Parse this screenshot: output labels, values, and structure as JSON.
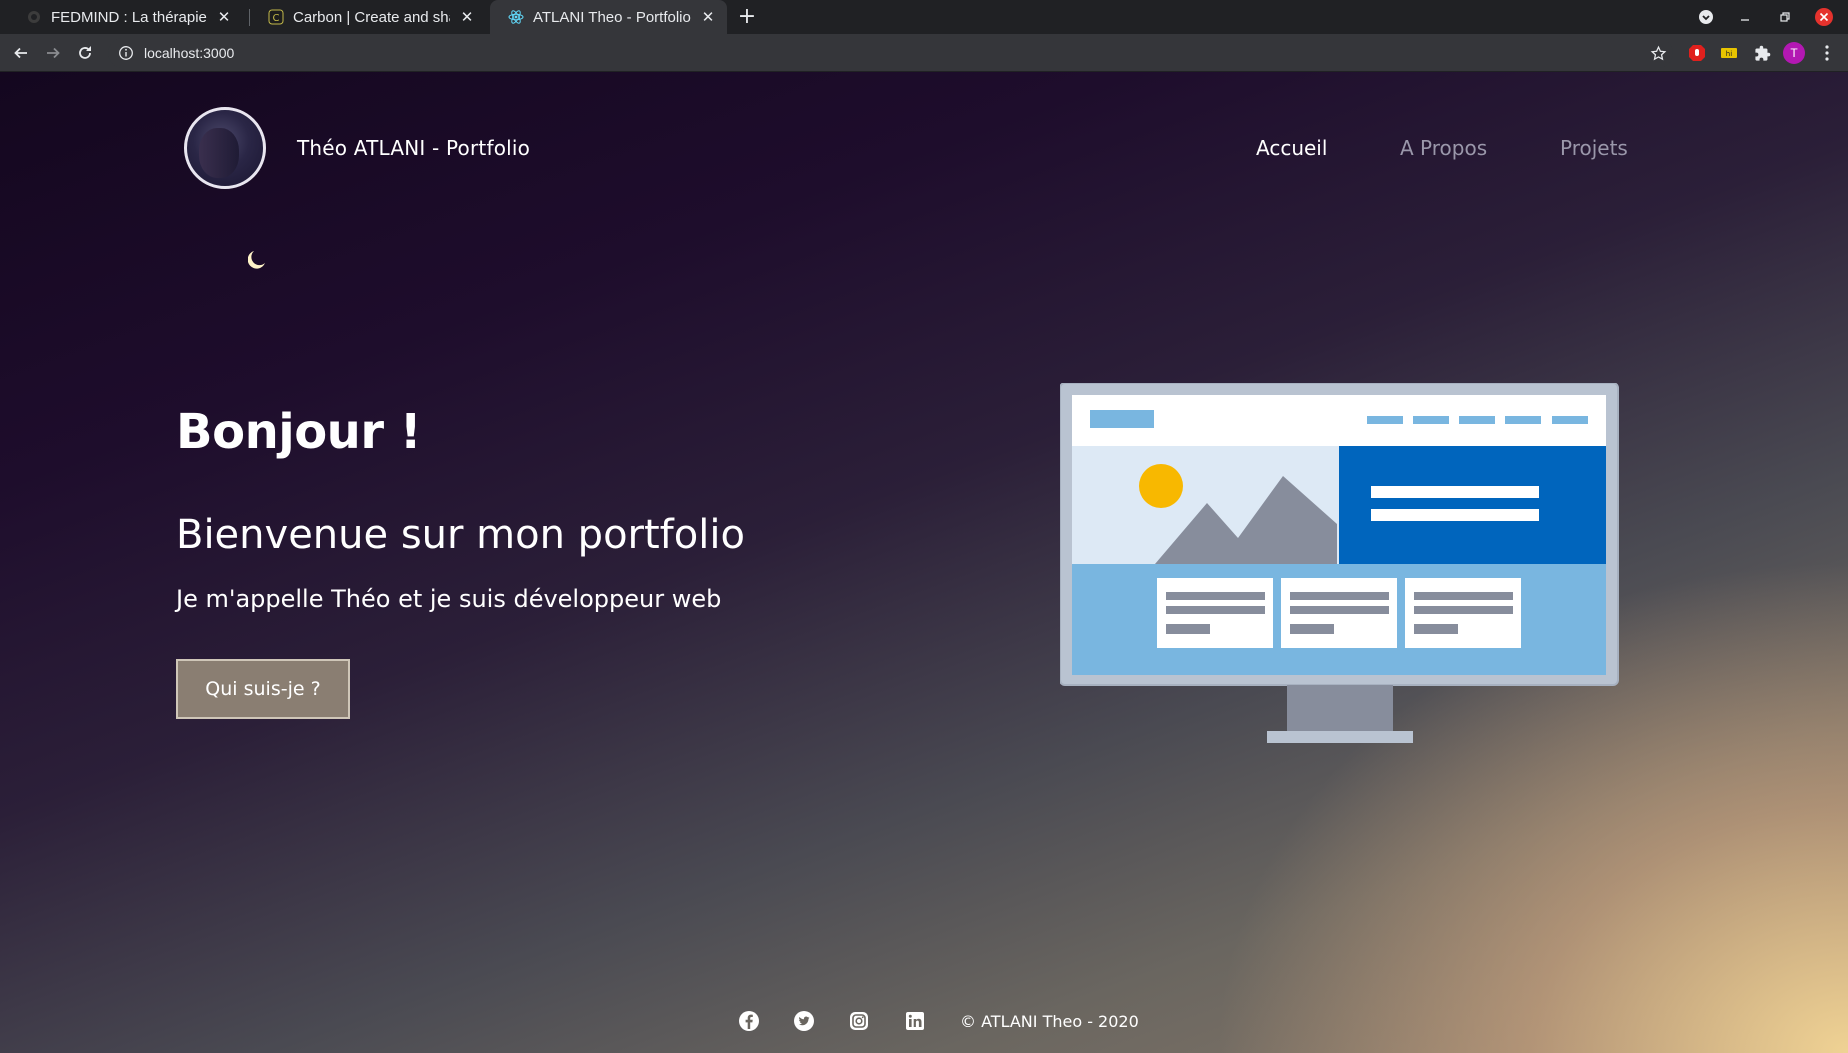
{
  "browser": {
    "tabs": [
      {
        "title": "FEDMIND : La thérapie di",
        "active": false,
        "favicon": "fedmind-favicon"
      },
      {
        "title": "Carbon | Create and share",
        "active": false,
        "favicon": "carbon-favicon"
      },
      {
        "title": "ATLANI Theo - Portfolio",
        "active": true,
        "favicon": "react-favicon"
      }
    ],
    "url": "localhost:3000",
    "profile_initial": "T"
  },
  "header": {
    "brand": "Théo ATLANI - Portfolio",
    "nav": [
      {
        "label": "Accueil",
        "active": true
      },
      {
        "label": "A Propos",
        "active": false
      },
      {
        "label": "Projets",
        "active": false
      }
    ]
  },
  "hero": {
    "title": "Bonjour !",
    "subtitle": "Bienvenue sur mon portfolio",
    "text": "Je m'appelle Théo et je suis développeur web",
    "cta_label": "Qui suis-je ?"
  },
  "footer": {
    "social_icons": [
      "facebook-icon",
      "twitter-icon",
      "instagram-icon",
      "linkedin-icon"
    ],
    "copyright": "© ATLANI Theo - 2020"
  },
  "colors": {
    "accent_blue": "#0065bd",
    "light_blue": "#79b6e0",
    "sun": "#f8b800",
    "cta_bg": "#8a7e72"
  }
}
